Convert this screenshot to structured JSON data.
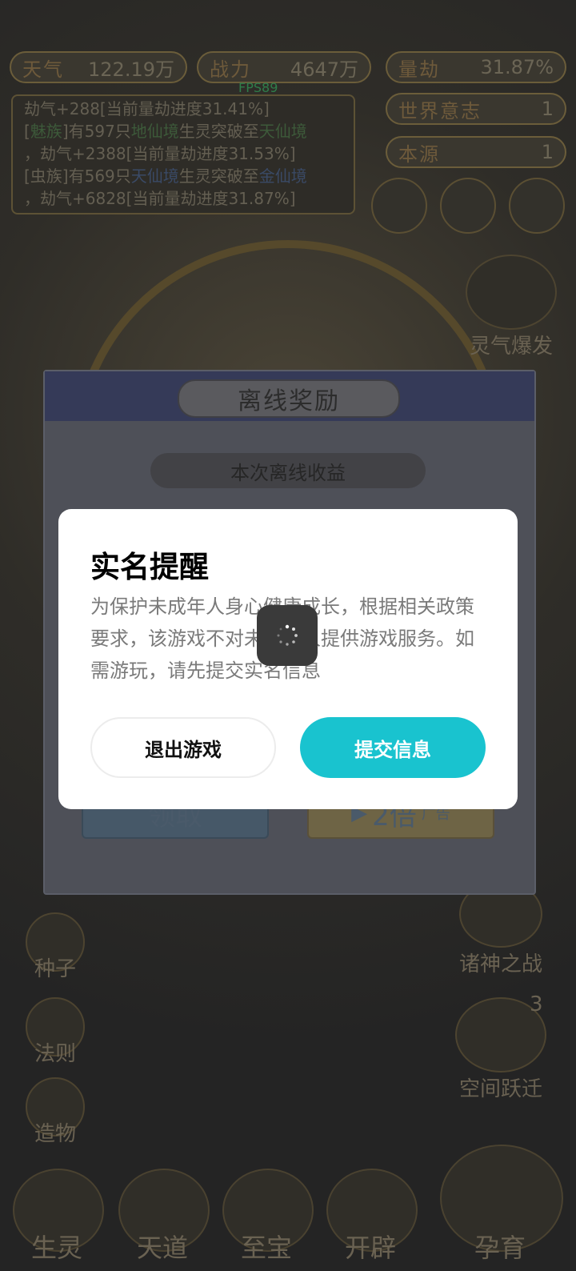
{
  "hud": {
    "tianqi": {
      "label": "天气",
      "value": "122.19万"
    },
    "zhanli": {
      "label": "战力",
      "value": "4647万"
    },
    "liangjie": {
      "label": "量劫",
      "value": "31.87%"
    },
    "world_will": {
      "label": "世界意志",
      "value": "1"
    },
    "benyuan": {
      "label": "本源",
      "value": "1"
    },
    "fps": "FPS89"
  },
  "log": {
    "line1": "劫气+288[当前量劫进度31.41%]",
    "line2a": "[",
    "line2_clan": "魅族",
    "line2b": "]有597只",
    "line2_from": "地仙境",
    "line2c": "生灵突破至",
    "line2_to": "天仙境",
    "line3": "，劫气+2388[当前量劫进度31.53%]",
    "line4a": "[虫族]有569只",
    "line4_from": "天仙境",
    "line4b": "生灵突破至",
    "line4_to": "金仙境",
    "line5": "，劫气+6828[当前量劫进度31.87%]"
  },
  "right_menu": {
    "burst": "灵气爆发",
    "gods_war": "诸神之战",
    "space_jump": "空间跃迁",
    "space_jump_badge": "3",
    "breed": "孕育"
  },
  "left_menu": {
    "seed": "种子",
    "law": "法则",
    "create": "造物"
  },
  "bottom_nav": [
    "生灵",
    "天道",
    "至宝",
    "开辟"
  ],
  "offline_panel": {
    "title": "离线奖励",
    "subtitle": "本次离线收益",
    "claim": "领取",
    "double": "2倍",
    "ad": "广告"
  },
  "dialog": {
    "title": "实名提醒",
    "body": "为保护未成年人身心健康成长，根据相关政策要求，该游戏不对未成年人提供游戏服务。如需游玩，请先提交实名信息",
    "exit_button": "退出游戏",
    "submit_button": "提交信息"
  },
  "colors": {
    "accent": "#19c3cf",
    "overlay": "#2a2a2a"
  }
}
